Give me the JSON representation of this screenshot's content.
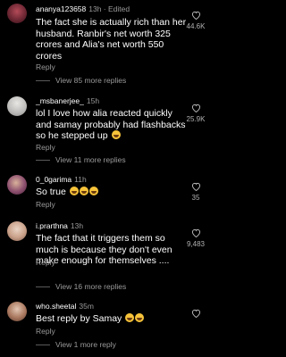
{
  "comments": [
    {
      "user": "ananya123658",
      "time": "13h · Edited",
      "text": "The fact she is actually rich than her husband. Ranbir's net worth 325 crores and Alia's net worth 550 crores",
      "emojis": 0,
      "reply_label": "Reply",
      "likes": "44.6K",
      "view_more": "View 85 more replies"
    },
    {
      "user": "_msbanerjee_",
      "time": "15h",
      "text": "lol I love how alia reacted quickly and samay probably had flashbacks so he stepped up",
      "emojis": 1,
      "reply_label": "Reply",
      "likes": "25.9K",
      "view_more": "View 11 more replies"
    },
    {
      "user": "0_0garima",
      "time": "11h",
      "text": "So true",
      "emojis": 3,
      "reply_label": "Reply",
      "likes": "35",
      "view_more": ""
    },
    {
      "user": "i.prarthna",
      "time": "13h",
      "text": "The fact that it triggers them so much is because they don't even make enough for themselves ....",
      "emojis": 0,
      "reply_label": "Reply",
      "likes": "9,483",
      "view_more": "View 16 more replies"
    },
    {
      "user": "who.sheetal",
      "time": "35m",
      "text": "Best reply by Samay",
      "emojis": 2,
      "reply_label": "Reply",
      "likes": "",
      "view_more": "View 1 more reply"
    }
  ],
  "icons": {
    "like": "heart-outline-icon",
    "emoji": "laughing-emoji-icon"
  },
  "colors": {
    "background": "#000000",
    "secondary_text": "#9a9a9a"
  }
}
